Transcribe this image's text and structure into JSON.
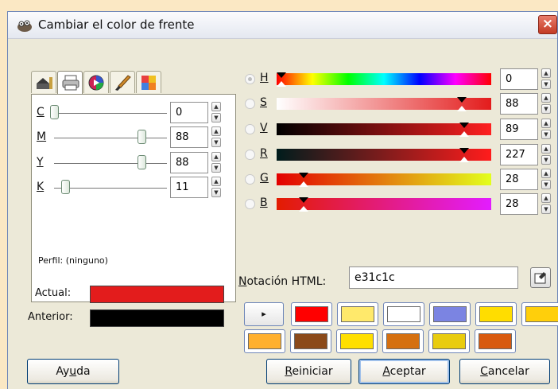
{
  "window": {
    "title": "Cambiar el color de frente",
    "close_label": "×",
    "icon": "gimp-icon"
  },
  "selector_tabs": [
    {
      "name": "gimp-selector-icon"
    },
    {
      "name": "printer-cmyk-icon",
      "active": true
    },
    {
      "name": "color-wheel-icon"
    },
    {
      "name": "paintbrush-icon"
    },
    {
      "name": "palette-icon"
    }
  ],
  "cmyk": {
    "channels": [
      {
        "key": "C",
        "value": "0",
        "level": 0
      },
      {
        "key": "M",
        "value": "88",
        "level": 0.88
      },
      {
        "key": "Y",
        "value": "88",
        "level": 0.88
      },
      {
        "key": "K",
        "value": "11",
        "level": 0.11
      }
    ],
    "profile": "Perfil: (ninguno)"
  },
  "compare": {
    "actual_label": "Actual:",
    "anterior_label": "Anterior:",
    "actual_color": "#e31c1c",
    "anterior_color": "#000000"
  },
  "scales": [
    {
      "key": "H",
      "value": "0",
      "level": 0,
      "selected": true
    },
    {
      "key": "S",
      "value": "88",
      "level": 0.88
    },
    {
      "key": "V",
      "value": "89",
      "level": 0.89
    },
    {
      "key": "R",
      "value": "227",
      "level": 0.89
    },
    {
      "key": "G",
      "value": "28",
      "level": 0.11
    },
    {
      "key": "B",
      "value": "28",
      "level": 0.11
    }
  ],
  "html_notation": {
    "label": "Notación HTML:",
    "value": "e31c1c"
  },
  "history": {
    "arrow": "▸",
    "colors": [
      "#ff0000",
      "#ffe96b",
      "#ffffff",
      "#7b84e2",
      "#ffdd00",
      "#ffcf0b",
      "#ffb02e",
      "#8b4a1a",
      "#ffdf00",
      "#d57010",
      "#e9cc0e",
      "#d85a10"
    ]
  },
  "buttons": {
    "help": {
      "pre": "Ay",
      "u": "u",
      "post": "da"
    },
    "reset": {
      "pre": "",
      "u": "R",
      "post": "einiciar"
    },
    "accept": {
      "pre": "",
      "u": "A",
      "post": "ceptar"
    },
    "cancel": {
      "pre": "",
      "u": "C",
      "post": "ancelar"
    }
  }
}
